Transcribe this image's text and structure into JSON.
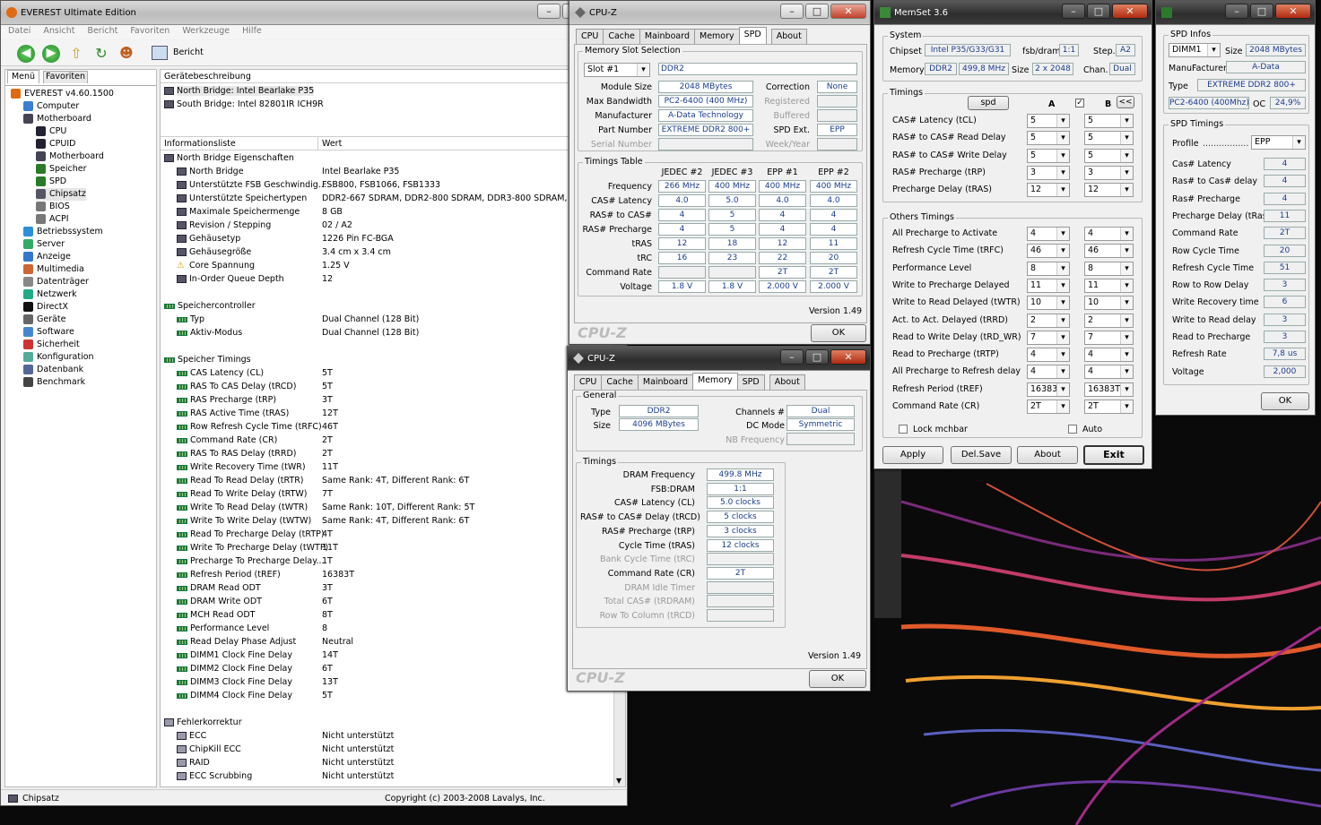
{
  "everest": {
    "title": "EVEREST Ultimate Edition",
    "menu": [
      "Datei",
      "Ansicht",
      "Bericht",
      "Favoriten",
      "Werkzeuge",
      "Hilfe"
    ],
    "report_label": "Bericht",
    "left_tabs": [
      "Menü",
      "Favoriten"
    ],
    "tree": [
      {
        "label": "EVEREST v4.60.1500",
        "color": "#e06a10"
      },
      {
        "label": "Computer",
        "color": "#3b7fd0"
      },
      {
        "label": "Motherboard",
        "color": "#445"
      },
      {
        "label": "CPU",
        "color": "#223"
      },
      {
        "label": "CPUID",
        "color": "#223"
      },
      {
        "label": "Motherboard",
        "color": "#445"
      },
      {
        "label": "Speicher",
        "color": "#2a7a2a"
      },
      {
        "label": "SPD",
        "color": "#2a7a2a"
      },
      {
        "label": "Chipsatz",
        "color": "#556"
      },
      {
        "label": "BIOS",
        "color": "#777"
      },
      {
        "label": "ACPI",
        "color": "#777"
      },
      {
        "label": "Betriebssystem",
        "color": "#2d8fd6"
      },
      {
        "label": "Server",
        "color": "#3a6"
      },
      {
        "label": "Anzeige",
        "color": "#37c"
      },
      {
        "label": "Multimedia",
        "color": "#c63"
      },
      {
        "label": "Datenträger",
        "color": "#888"
      },
      {
        "label": "Netzwerk",
        "color": "#2a8"
      },
      {
        "label": "DirectX",
        "color": "#111"
      },
      {
        "label": "Geräte",
        "color": "#666"
      },
      {
        "label": "Software",
        "color": "#48c"
      },
      {
        "label": "Sicherheit",
        "color": "#c33"
      },
      {
        "label": "Konfiguration",
        "color": "#5a9"
      },
      {
        "label": "Datenbank",
        "color": "#569"
      },
      {
        "label": "Benchmark",
        "color": "#444"
      }
    ],
    "device_header": "Gerätebeschreibung",
    "devices": [
      "North Bridge: Intel Bearlake P35",
      "South Bridge: Intel 82801IR ICH9R"
    ],
    "col_info": "Informationsliste",
    "col_value": "Wert",
    "sections": [
      {
        "title": "North Bridge Eigenschaften",
        "rows": [
          [
            "North Bridge",
            "Intel Bearlake P35"
          ],
          [
            "Unterstützte FSB Geschwindig...",
            "FSB800, FSB1066, FSB1333"
          ],
          [
            "Unterstützte Speichertypen",
            "DDR2-667 SDRAM, DDR2-800 SDRAM, DDR3-800 SDRAM, DDR3-"
          ],
          [
            "Maximale Speichermenge",
            "8 GB"
          ],
          [
            "Revision / Stepping",
            "02 / A2"
          ],
          [
            "Gehäusetyp",
            "1226 Pin FC-BGA"
          ],
          [
            "Gehäusegröße",
            "3.4 cm x 3.4 cm"
          ],
          [
            "Core Spannung",
            "1.25 V"
          ],
          [
            "In-Order Queue Depth",
            "12"
          ]
        ]
      },
      {
        "title": "Speichercontroller",
        "rows": [
          [
            "Typ",
            "Dual Channel  (128 Bit)"
          ],
          [
            "Aktiv-Modus",
            "Dual Channel  (128 Bit)"
          ]
        ]
      },
      {
        "title": "Speicher Timings",
        "rows": [
          [
            "CAS Latency (CL)",
            "5T"
          ],
          [
            "RAS To CAS Delay (tRCD)",
            "5T"
          ],
          [
            "RAS Precharge (tRP)",
            "3T"
          ],
          [
            "RAS Active Time (tRAS)",
            "12T"
          ],
          [
            "Row Refresh Cycle Time (tRFC)",
            "46T"
          ],
          [
            "Command Rate (CR)",
            "2T"
          ],
          [
            "RAS To RAS Delay (tRRD)",
            "2T"
          ],
          [
            "Write Recovery Time (tWR)",
            "11T"
          ],
          [
            "Read To Read Delay (tRTR)",
            "Same Rank: 4T, Different Rank: 6T"
          ],
          [
            "Read To Write Delay (tRTW)",
            "7T"
          ],
          [
            "Write To Read Delay (tWTR)",
            "Same Rank: 10T, Different Rank: 5T"
          ],
          [
            "Write To Write Delay (tWTW)",
            "Same Rank: 4T, Different Rank: 6T"
          ],
          [
            "Read To Precharge Delay (tRTP)",
            "4T"
          ],
          [
            "Write To Precharge Delay (tWTP)",
            "11T"
          ],
          [
            "Precharge To Precharge Delay...",
            "1T"
          ],
          [
            "Refresh Period (tREF)",
            "16383T"
          ],
          [
            "DRAM Read ODT",
            "3T"
          ],
          [
            "DRAM Write ODT",
            "6T"
          ],
          [
            "MCH Read ODT",
            "8T"
          ],
          [
            "Performance Level",
            "8"
          ],
          [
            "Read Delay Phase Adjust",
            "Neutral"
          ],
          [
            "DIMM1 Clock Fine Delay",
            "14T"
          ],
          [
            "DIMM2 Clock Fine Delay",
            "6T"
          ],
          [
            "DIMM3 Clock Fine Delay",
            "13T"
          ],
          [
            "DIMM4 Clock Fine Delay",
            "5T"
          ]
        ]
      },
      {
        "title": "Fehlerkorrektur",
        "rows": [
          [
            "ECC",
            "Nicht unterstützt"
          ],
          [
            "ChipKill ECC",
            "Nicht unterstützt"
          ],
          [
            "RAID",
            "Nicht unterstützt"
          ],
          [
            "ECC Scrubbing",
            "Nicht unterstützt"
          ]
        ]
      }
    ],
    "status_left": "Chipsatz",
    "status_right": "Copyright (c) 2003-2008 Lavalys, Inc."
  },
  "cpuz_spd": {
    "title": "CPU-Z",
    "tabs": [
      "CPU",
      "Cache",
      "Mainboard",
      "Memory",
      "SPD",
      "About"
    ],
    "active_tab": "SPD",
    "slot_group": "Memory Slot Selection",
    "slot": "Slot #1",
    "mem_type": "DDR2",
    "left_labels": [
      "Module Size",
      "Max Bandwidth",
      "Manufacturer",
      "Part Number",
      "Serial Number"
    ],
    "left_values": [
      "2048 MBytes",
      "PC2-6400 (400 MHz)",
      "A-Data Technology",
      "EXTREME DDR2 800+",
      ""
    ],
    "right_labels": [
      "Correction",
      "Registered",
      "Buffered",
      "SPD Ext.",
      "Week/Year"
    ],
    "right_values": [
      "None",
      "",
      "",
      "EPP",
      ""
    ],
    "timings_group": "Timings Table",
    "timing_cols": [
      "JEDEC #2",
      "JEDEC #3",
      "EPP #1",
      "EPP #2"
    ],
    "timing_rows": [
      {
        "label": "Frequency",
        "values": [
          "266 MHz",
          "400 MHz",
          "400 MHz",
          "400 MHz"
        ]
      },
      {
        "label": "CAS# Latency",
        "values": [
          "4.0",
          "5.0",
          "4.0",
          "4.0"
        ]
      },
      {
        "label": "RAS# to CAS#",
        "values": [
          "4",
          "5",
          "4",
          "4"
        ]
      },
      {
        "label": "RAS# Precharge",
        "values": [
          "4",
          "5",
          "4",
          "4"
        ]
      },
      {
        "label": "tRAS",
        "values": [
          "12",
          "18",
          "12",
          "11"
        ]
      },
      {
        "label": "tRC",
        "values": [
          "16",
          "23",
          "22",
          "20"
        ]
      },
      {
        "label": "Command Rate",
        "values": [
          "",
          "",
          "2T",
          "2T"
        ]
      },
      {
        "label": "Voltage",
        "values": [
          "1.8 V",
          "1.8 V",
          "2.000 V",
          "2.000 V"
        ]
      }
    ],
    "version": "Version 1.49",
    "logo": "CPU-Z",
    "ok": "OK"
  },
  "cpuz_mem": {
    "title": "CPU-Z",
    "tabs": [
      "CPU",
      "Cache",
      "Mainboard",
      "Memory",
      "SPD",
      "About"
    ],
    "active_tab": "Memory",
    "general_group": "General",
    "type_label": "Type",
    "type": "DDR2",
    "size_label": "Size",
    "size": "4096 MBytes",
    "channels_label": "Channels #",
    "channels": "Dual",
    "dcmode_label": "DC Mode",
    "dcmode": "Symmetric",
    "nbfreq_label": "NB Frequency",
    "nbfreq": "",
    "timings_group": "Timings",
    "timings": [
      {
        "label": "DRAM Frequency",
        "value": "499.8 MHz",
        "dim": false
      },
      {
        "label": "FSB:DRAM",
        "value": "1:1",
        "dim": false
      },
      {
        "label": "CAS# Latency (CL)",
        "value": "5.0 clocks",
        "dim": false
      },
      {
        "label": "RAS# to CAS# Delay (tRCD)",
        "value": "5 clocks",
        "dim": false
      },
      {
        "label": "RAS# Precharge (tRP)",
        "value": "3 clocks",
        "dim": false
      },
      {
        "label": "Cycle Time (tRAS)",
        "value": "12 clocks",
        "dim": false
      },
      {
        "label": "Bank Cycle Time (tRC)",
        "value": "",
        "dim": true
      },
      {
        "label": "Command Rate (CR)",
        "value": "2T",
        "dim": false
      },
      {
        "label": "DRAM Idle Timer",
        "value": "",
        "dim": true
      },
      {
        "label": "Total CAS# (tRDRAM)",
        "value": "",
        "dim": true
      },
      {
        "label": "Row To Column (tRCD)",
        "value": "",
        "dim": true
      }
    ],
    "version": "Version 1.49",
    "logo": "CPU-Z",
    "ok": "OK"
  },
  "memset": {
    "title": "MemSet 3.6",
    "system_group": "System",
    "chipset_label": "Chipset",
    "chipset": "Intel P35/G33/G31",
    "fsbdram_label": "fsb/dram",
    "fsbdram": "1:1",
    "step_label": "Step.",
    "step": "A2",
    "memory_label": "Memory",
    "memory": "DDR2",
    "freq": "499,8 MHz",
    "size_label": "Size",
    "size": "2 x 2048",
    "chan_label": "Chan.",
    "chan": "Dual",
    "timings_group": "Timings",
    "spd_btn": "spd",
    "col_a": "A",
    "col_b": "B",
    "link_btn": "<<",
    "timings": [
      {
        "label": "CAS# Latency (tCL)",
        "a": "5",
        "b": "5"
      },
      {
        "label": "RAS# to CAS# Read Delay",
        "a": "5",
        "b": "5"
      },
      {
        "label": "RAS# to CAS# Write Delay",
        "a": "5",
        "b": "5"
      },
      {
        "label": "RAS# Precharge (tRP)",
        "a": "3",
        "b": "3"
      },
      {
        "label": "Precharge Delay  (tRAS)",
        "a": "12",
        "b": "12"
      }
    ],
    "others_group": "Others Timings",
    "others": [
      {
        "label": "All Precharge to Activate",
        "a": "4",
        "b": "4"
      },
      {
        "label": "Refresh Cycle Time (tRFC)",
        "a": "46",
        "b": "46"
      },
      {
        "label": "Performance Level",
        "a": "8",
        "b": "8"
      },
      {
        "label": "Write to Precharge Delayed",
        "a": "11",
        "b": "11"
      },
      {
        "label": "Write to Read Delayed (tWTR)",
        "a": "10",
        "b": "10"
      },
      {
        "label": "Act. to Act. Delayed (tRRD)",
        "a": "2",
        "b": "2"
      },
      {
        "label": "Read to Write Delay (tRD_WR)",
        "a": "7",
        "b": "7"
      },
      {
        "label": "Read to Precharge (tRTP)",
        "a": "4",
        "b": "4"
      },
      {
        "label": "All Precharge to Refresh delay",
        "a": "4",
        "b": "4"
      },
      {
        "label": "Refresh Period (tREF)",
        "a": "16383T",
        "b": "16383T"
      },
      {
        "label": "Command Rate (CR)",
        "a": "2T",
        "b": "2T"
      }
    ],
    "lock_label": "Lock mchbar",
    "auto_label": "Auto",
    "buttons": [
      "Apply",
      "Del.Save",
      "About",
      "Exit"
    ]
  },
  "spdwin": {
    "spd_infos_group": "SPD Infos",
    "dimm": "DIMM1",
    "size_label": "Size",
    "size": "2048 MBytes",
    "manuf_label": "ManuFacturer",
    "manuf": "A-Data",
    "type_label": "Type",
    "type": "EXTREME DDR2 800+",
    "pc": "PC2-6400 (400Mhz)",
    "oc_label": "OC",
    "oc": "24,9%",
    "timings_group": "SPD Timings",
    "profile_label": "Profile",
    "profile": "EPP",
    "rows": [
      {
        "label": "Cas# Latency",
        "value": "4"
      },
      {
        "label": "Ras# to Cas# delay",
        "value": "4"
      },
      {
        "label": "Ras# Precharge",
        "value": "4"
      },
      {
        "label": "Precharge Delay (tRas)",
        "value": "11"
      },
      {
        "label": "Command Rate",
        "value": "2T"
      },
      {
        "label": "Row Cycle Time",
        "value": "20"
      },
      {
        "label": "Refresh Cycle Time",
        "value": "51"
      },
      {
        "label": "Row to Row Delay",
        "value": "3"
      },
      {
        "label": "Write Recovery time",
        "value": "6"
      },
      {
        "label": "Write to Read delay",
        "value": "3"
      },
      {
        "label": "Read to Precharge",
        "value": "3"
      },
      {
        "label": "Refresh Rate",
        "value": "7,8 us"
      },
      {
        "label": "Voltage",
        "value": "2,000"
      }
    ],
    "ok": "OK"
  }
}
